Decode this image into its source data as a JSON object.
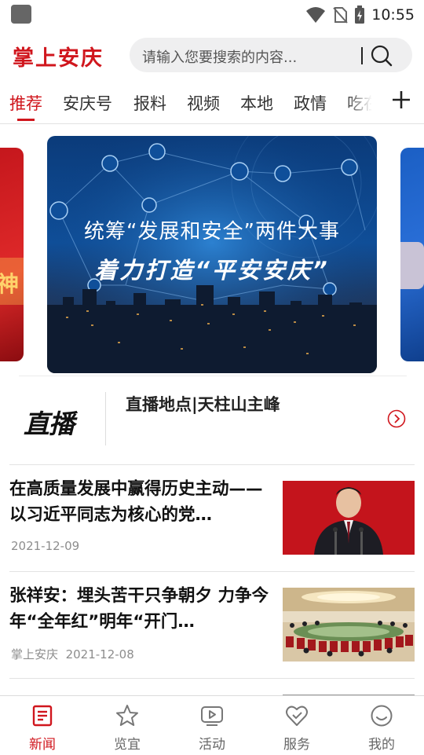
{
  "status_bar": {
    "time": "10:55"
  },
  "header": {
    "logo_text": "掌上安庆",
    "search_placeholder": "请输入您要搜索的内容..."
  },
  "tabs": [
    {
      "label": "推荐",
      "active": true
    },
    {
      "label": "安庆号"
    },
    {
      "label": "报料"
    },
    {
      "label": "视频"
    },
    {
      "label": "本地"
    },
    {
      "label": "政情"
    },
    {
      "label": "吃在"
    }
  ],
  "carousel": {
    "main_slide": {
      "line1": "统筹“发展和安全”两件大事",
      "line2": "着力打造“平安安庆”"
    },
    "left_slide_glyph": "神"
  },
  "live": {
    "logo_text": "直播",
    "title": "直播地点|天柱山主峰"
  },
  "news": [
    {
      "title": "在高质量发展中赢得历史主动——以习近平同志为核心的党…",
      "source": "",
      "date": "2021-12-09"
    },
    {
      "title": "张祥安：埋头苦干只争朝夕 力争今年“全年红”明年“开门…",
      "source": "掌上安庆",
      "date": "2021-12-08"
    }
  ],
  "bottom_nav": [
    {
      "label": "新闻",
      "icon": "news-icon",
      "active": true
    },
    {
      "label": "览宜",
      "icon": "star-icon"
    },
    {
      "label": "活动",
      "icon": "play-icon"
    },
    {
      "label": "服务",
      "icon": "heart-check-icon"
    },
    {
      "label": "我的",
      "icon": "smile-icon"
    }
  ],
  "colors": {
    "accent": "#d0161d"
  }
}
